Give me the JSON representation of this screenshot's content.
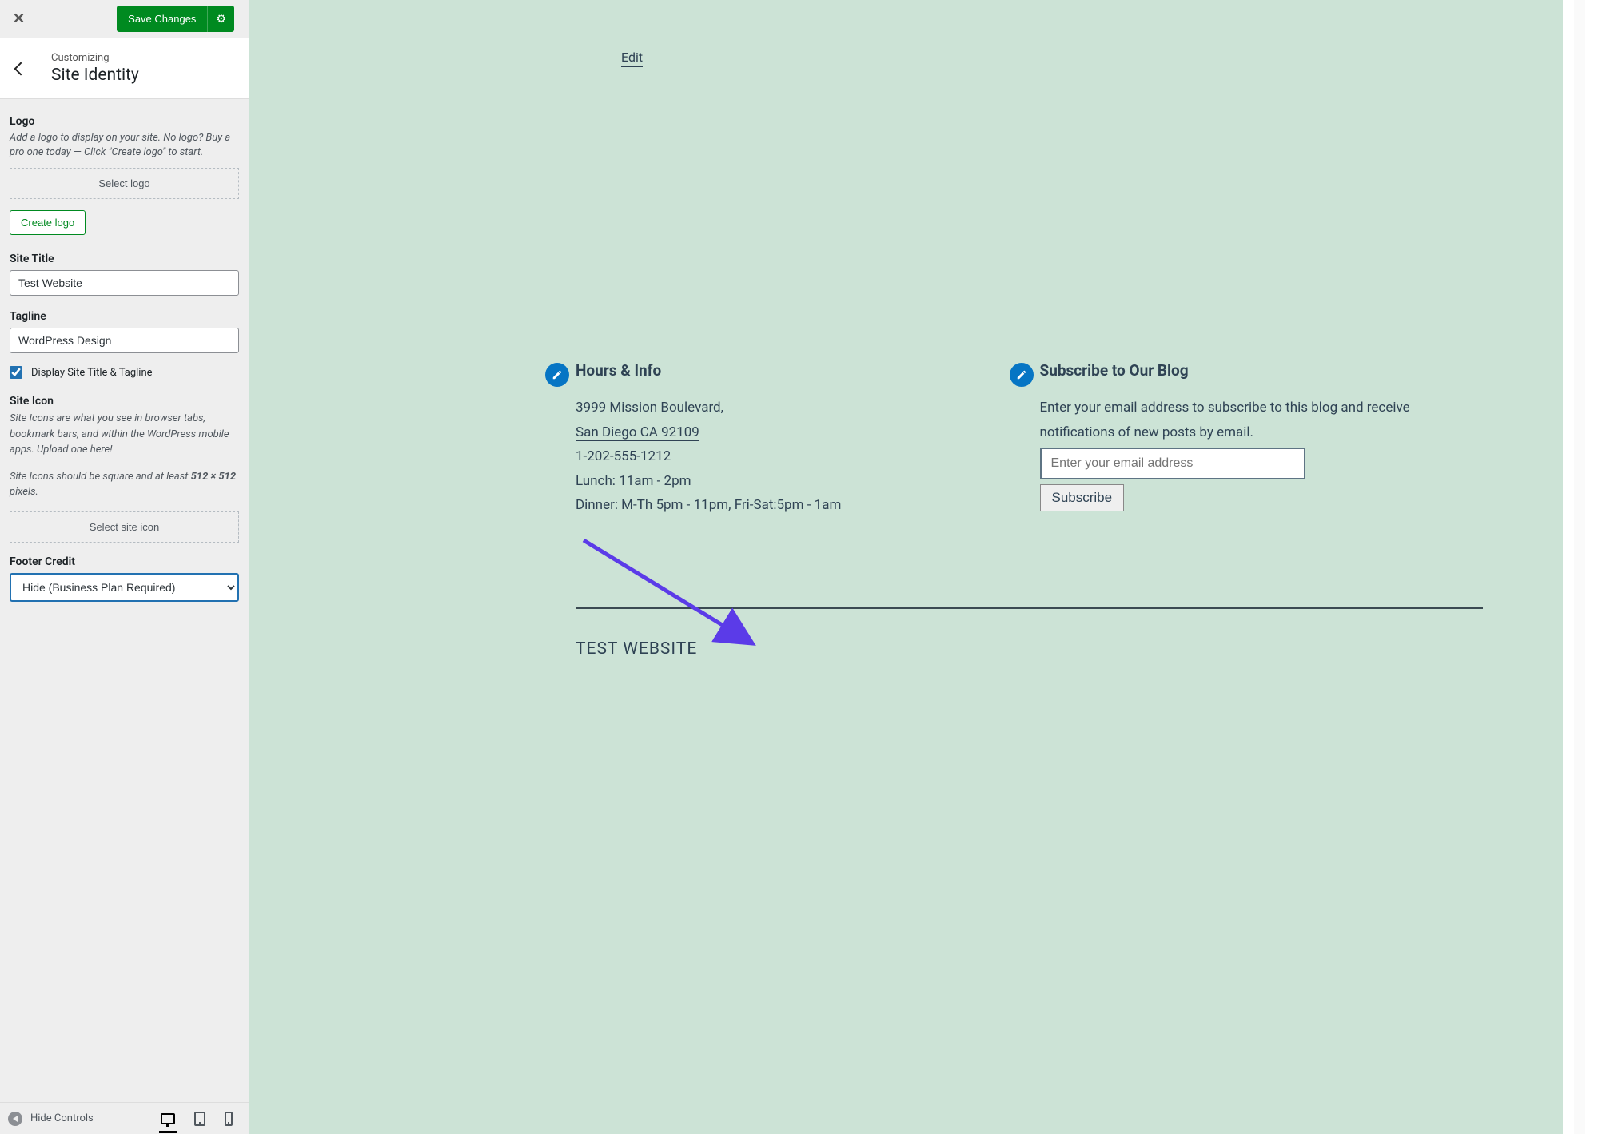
{
  "sidebar": {
    "save_label": "Save Changes",
    "customizing_label": "Customizing",
    "section_title": "Site Identity",
    "logo": {
      "heading": "Logo",
      "description": "Add a logo to display on your site. No logo? Buy a pro one today — Click \"Create logo\" to start.",
      "select_button": "Select logo",
      "create_button": "Create logo"
    },
    "site_title": {
      "label": "Site Title",
      "value": "Test Website"
    },
    "tagline": {
      "label": "Tagline",
      "value": "WordPress Design"
    },
    "display_checkbox": {
      "label": "Display Site Title & Tagline",
      "checked": true
    },
    "site_icon": {
      "heading": "Site Icon",
      "description1": "Site Icons are what you see in browser tabs, bookmark bars, and within the WordPress mobile apps. Upload one here!",
      "description2_pre": "Site Icons should be square and at least ",
      "description2_bold": "512 × 512",
      "description2_post": " pixels.",
      "select_button": "Select site icon"
    },
    "footer_credit": {
      "label": "Footer Credit",
      "value": "Hide (Business Plan Required)"
    },
    "hide_controls": "Hide Controls"
  },
  "preview": {
    "edit_label": "Edit",
    "hours_info": {
      "title": "Hours & Info",
      "address_line1": "3999 Mission Boulevard,",
      "address_line2": "San Diego CA 92109",
      "phone": "1-202-555-1212",
      "lunch": "Lunch: 11am - 2pm",
      "dinner": "Dinner: M-Th 5pm - 11pm, Fri-Sat:5pm - 1am"
    },
    "subscribe": {
      "title": "Subscribe to Our Blog",
      "blurb": "Enter your email address to subscribe to this blog and receive notifications of new posts by email.",
      "placeholder": "Enter your email address",
      "button": "Subscribe"
    },
    "footer_site_title": "TEST WEBSITE"
  }
}
